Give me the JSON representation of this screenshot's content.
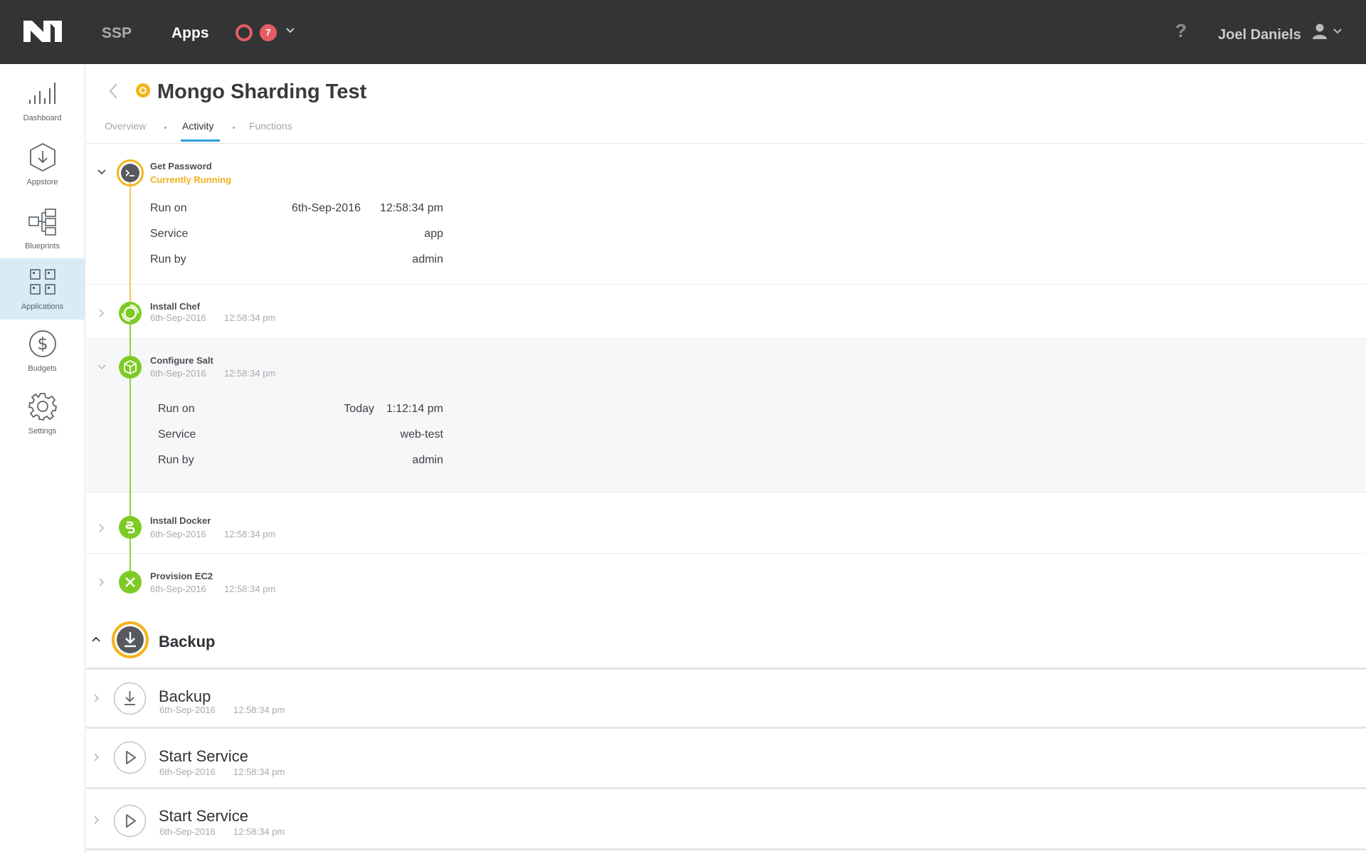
{
  "topbar": {
    "nav": [
      {
        "label": "SSP"
      },
      {
        "label": "Apps"
      }
    ],
    "alerts_count": "7",
    "help_label": "?",
    "user_name": "Joel Daniels"
  },
  "sidebar": {
    "items": [
      {
        "label": "Dashboard",
        "icon": "bar-chart-icon"
      },
      {
        "label": "Appstore",
        "icon": "download-hexagon-icon"
      },
      {
        "label": "Blueprints",
        "icon": "blueprint-icon"
      },
      {
        "label": "Applications",
        "icon": "grid-icon",
        "active": true
      },
      {
        "label": "Budgets",
        "icon": "dollar-icon"
      },
      {
        "label": "Settings",
        "icon": "gear-icon"
      }
    ]
  },
  "header": {
    "title": "Mongo Sharding Test",
    "tabs": [
      {
        "label": "Overview"
      },
      {
        "label": "Activity",
        "active": true
      },
      {
        "label": "Functions"
      }
    ]
  },
  "activity": {
    "steps": [
      {
        "title": "Get Password",
        "status": "Currently Running",
        "icon": "terminal-icon",
        "details": {
          "run_on_label": "Run on",
          "run_on_date": "6th-Sep-2016",
          "run_on_time": "12:58:34 pm",
          "service_label": "Service",
          "service": "app",
          "run_by_label": "Run by",
          "run_by": "admin"
        }
      },
      {
        "title": "Install Chef",
        "date": "6th-Sep-2016",
        "time": "12:58:34 pm",
        "icon": "chef-icon"
      },
      {
        "title": "Configure Salt",
        "date": "6th-Sep-2016",
        "time": "12:58:34 pm",
        "icon": "salt-icon",
        "details": {
          "run_on_label": "Run on",
          "run_on_date": "Today",
          "run_on_time": "1:12:14 pm",
          "service_label": "Service",
          "service": "web-test",
          "run_by_label": "Run by",
          "run_by": "admin"
        }
      },
      {
        "title": "Install Docker",
        "date": "6th-Sep-2016",
        "time": "12:58:34 pm",
        "icon": "docker-icon"
      },
      {
        "title": "Provision EC2",
        "date": "6th-Sep-2016",
        "time": "12:58:34 pm",
        "icon": "ec2-icon"
      }
    ],
    "group": {
      "title": "Backup",
      "icon": "download-icon",
      "items": [
        {
          "title": "Backup",
          "date": "6th-Sep-2016",
          "time": "12:58:34 pm",
          "icon": "download-icon"
        },
        {
          "title": "Start Service",
          "date": "6th-Sep-2016",
          "time": "12:58:34 pm",
          "icon": "play-icon"
        },
        {
          "title": "Start Service",
          "date": "6th-Sep-2016",
          "time": "12:58:34 pm",
          "icon": "play-icon"
        }
      ]
    }
  },
  "colors": {
    "topbar": "#333436",
    "running": "#f4b41a",
    "success": "#7dcb24",
    "accent": "#2b9de0",
    "alert": "#e35d62",
    "active_nav_bg": "#d8ecf8"
  }
}
